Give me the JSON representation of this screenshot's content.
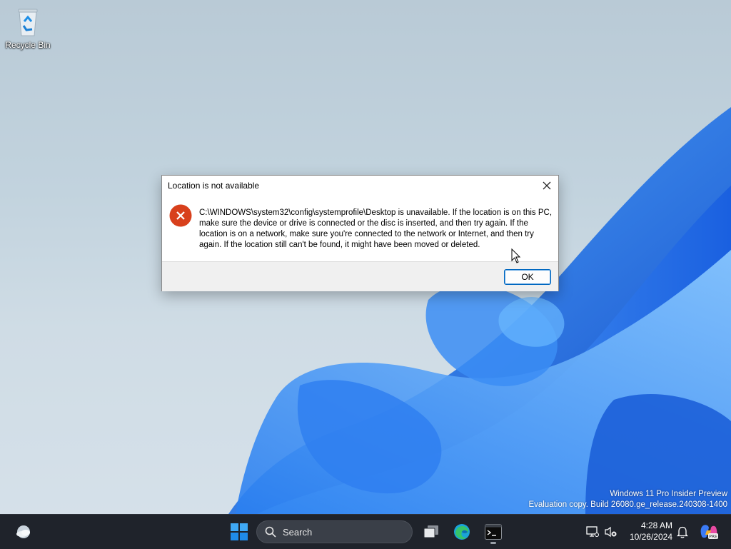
{
  "desktop": {
    "icons": [
      {
        "label": "Recycle Bin",
        "icon": "recycle-bin-icon"
      }
    ],
    "watermark": {
      "line1": "Windows 11 Pro Insider Preview",
      "line2": "Evaluation copy. Build 26080.ge_release.240308-1400"
    }
  },
  "dialog": {
    "title": "Location is not available",
    "icon": "error-icon",
    "message": "C:\\WINDOWS\\system32\\config\\systemprofile\\Desktop is unavailable. If the location is on this PC, make sure the device or drive is connected or the disc is inserted, and then try again. If the location is on a network, make sure you're connected to the network or Internet, and then try again. If the location still can't be found, it might have been moved or deleted.",
    "ok_label": "OK",
    "close_icon": "close-icon"
  },
  "taskbar": {
    "search_placeholder": "Search",
    "pinned": [
      "weather-icon",
      "start-icon",
      "task-view-icon",
      "edge-icon",
      "terminal-icon"
    ],
    "clock": {
      "time": "4:28 AM",
      "date": "10/26/2024"
    },
    "tray": [
      "network-icon",
      "volume-muted-icon",
      "notification-bell-icon",
      "copilot-icon"
    ]
  },
  "colors": {
    "taskbar_bg": "#1f232b",
    "error_red": "#d8401c",
    "accent_blue": "#0067c0",
    "bloom_blue": "#1e6fe8"
  }
}
